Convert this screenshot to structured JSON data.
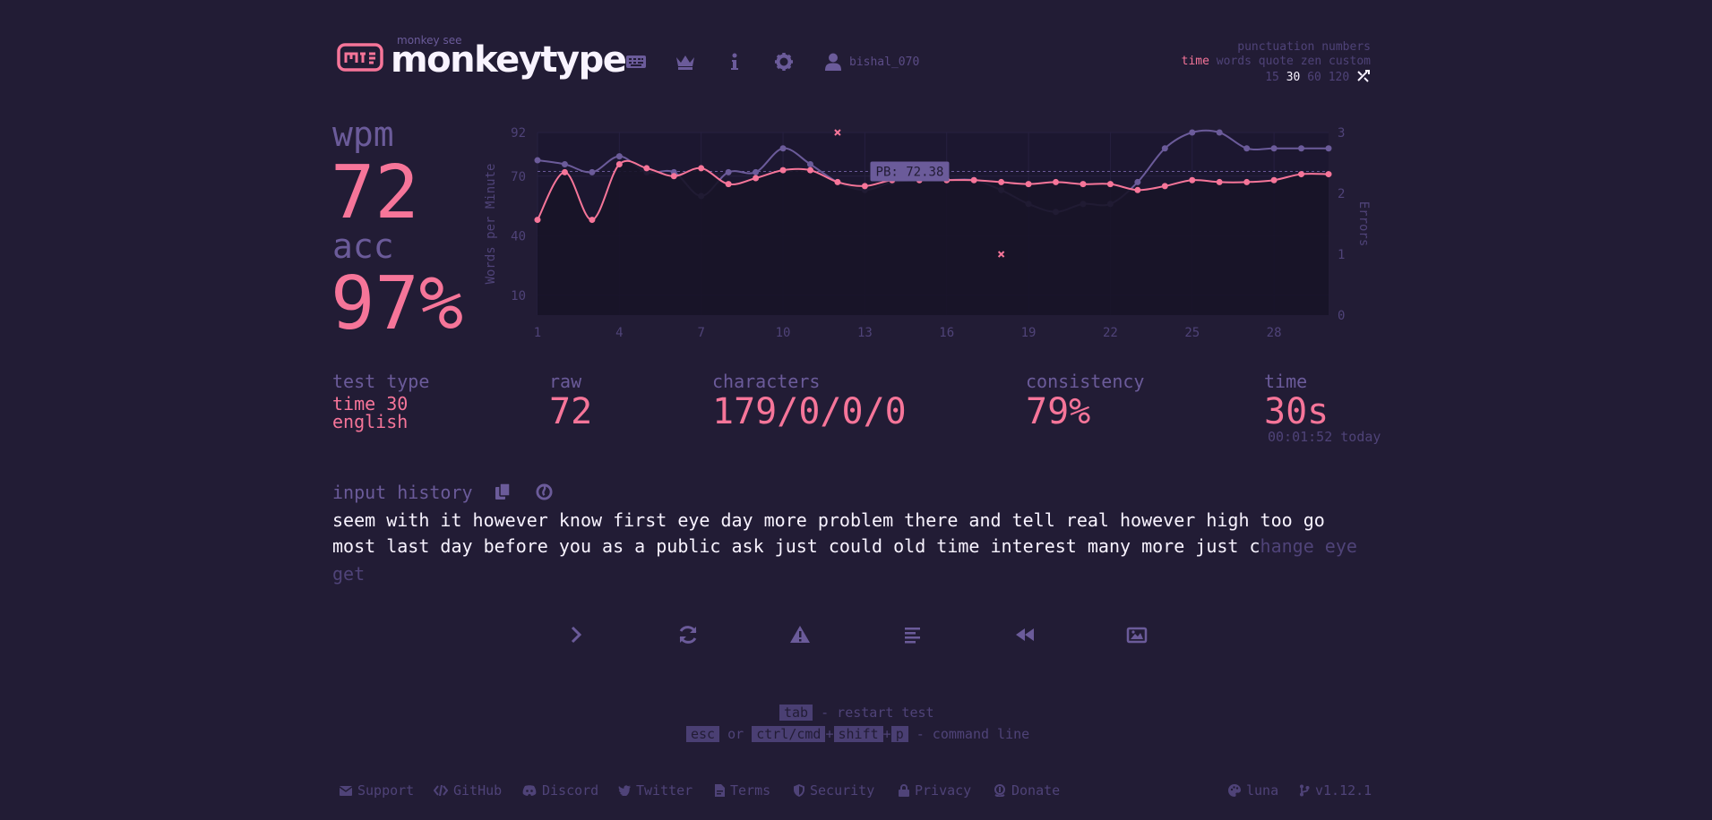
{
  "header": {
    "logo_small": "monkey see",
    "logo_text": "monkeytype",
    "username": "bishal_070",
    "nav_icons": [
      "keyboard-icon",
      "crown-icon",
      "info-icon",
      "gear-icon",
      "user-icon"
    ]
  },
  "config": {
    "line1": "punctuation numbers",
    "modes": [
      "time",
      "words",
      "quote",
      "zen",
      "custom"
    ],
    "active_mode": "time",
    "times": [
      "15",
      "30",
      "60",
      "120"
    ],
    "active_time": "30"
  },
  "result": {
    "wpm_label": "wpm",
    "wpm": "72",
    "acc_label": "acc",
    "acc": "97%"
  },
  "stats": {
    "test_type_label": "test type",
    "test_type_line1": "time 30",
    "test_type_line2": "english",
    "raw_label": "raw",
    "raw": "72",
    "characters_label": "characters",
    "characters": "179/0/0/0",
    "consistency_label": "consistency",
    "consistency": "79%",
    "time_label": "time",
    "time": "30s",
    "time_sub": "00:01:52 today"
  },
  "history": {
    "label": "input history",
    "line1": "seem with it however know first eye day more problem there and tell real however high too go",
    "line2_typed": "most last day before you as a public ask just could old time interest many more just c",
    "line2_untyped": "hange eye",
    "line3_untyped": "get"
  },
  "actions": [
    "next-test-icon",
    "restart-icon",
    "report-icon",
    "words-history-icon",
    "replay-icon",
    "screenshot-icon"
  ],
  "hints": {
    "tab_key": "tab",
    "tab_text": " - restart test",
    "esc_key": "esc",
    "or": " or ",
    "ctrl_key": "ctrl/cmd",
    "plus": "+",
    "shift_key": "shift",
    "p_key": "p",
    "cmd_text": " - command line"
  },
  "footer": {
    "support": "Support",
    "github": "GitHub",
    "discord": "Discord",
    "twitter": "Twitter",
    "terms": "Terms",
    "security": "Security",
    "privacy": "Privacy",
    "donate": "Donate",
    "theme": "luna",
    "version": "v1.12.1"
  },
  "colors": {
    "background": "#221c35",
    "main": "#f67599",
    "sub": "#6b5b9a",
    "text": "#f8f3ff"
  },
  "chart_data": {
    "type": "line",
    "ylabel": "Words per Minute",
    "y2label": "Errors",
    "x_ticks": [
      "1",
      "4",
      "7",
      "10",
      "13",
      "16",
      "19",
      "22",
      "25",
      "28"
    ],
    "y_ticks": [
      "10",
      "40",
      "70",
      "92"
    ],
    "y2_ticks": [
      "0",
      "1",
      "2",
      "3"
    ],
    "ylim": [
      0,
      92
    ],
    "y2lim": [
      0,
      3
    ],
    "pb_label": "PB: 72.38",
    "pb_value": 72.38,
    "x": [
      1,
      2,
      3,
      4,
      5,
      6,
      7,
      8,
      9,
      10,
      11,
      12,
      13,
      14,
      15,
      16,
      17,
      18,
      19,
      20,
      21,
      22,
      23,
      24,
      25,
      26,
      27,
      28,
      29,
      30
    ],
    "series": [
      {
        "name": "wpm",
        "color": "#f67599",
        "values": [
          48,
          72,
          48,
          76,
          74,
          70,
          74,
          66,
          69,
          73,
          73,
          67,
          65,
          68,
          68,
          68,
          68,
          67,
          66,
          67,
          66,
          66,
          63,
          65,
          68,
          67,
          67,
          68,
          71,
          71
        ]
      },
      {
        "name": "raw",
        "color": "#6b5b9a",
        "values": [
          78,
          76,
          72,
          80,
          72,
          72,
          60,
          72,
          72,
          84,
          76,
          67,
          63,
          67,
          68,
          68,
          68,
          63,
          56,
          52,
          56,
          56,
          67,
          84,
          92,
          92,
          84,
          84,
          84,
          84
        ]
      }
    ],
    "errors": [
      {
        "x": 12,
        "y": 3
      },
      {
        "x": 18,
        "y": 1
      }
    ]
  }
}
